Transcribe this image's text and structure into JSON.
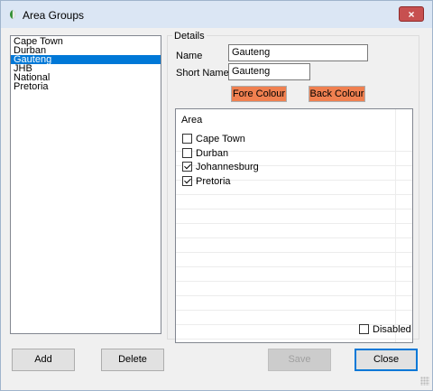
{
  "window": {
    "title": "Area Groups",
    "close_glyph": "×"
  },
  "area_list": {
    "items": [
      "Cape Town",
      "Durban",
      "Gauteng",
      "JHB",
      "National",
      "Pretoria"
    ],
    "selected": "Gauteng"
  },
  "details": {
    "group_title": "Details",
    "name_label": "Name",
    "name_value": "Gauteng",
    "short_name_label": "Short Name",
    "short_name_value": "Gauteng",
    "fore_colour_label": "Fore Colour",
    "back_colour_label": "Back Colour",
    "colour_swatch": "#f08050"
  },
  "area_grid": {
    "header": "Area",
    "rows": [
      {
        "label": "Cape Town",
        "checked": false
      },
      {
        "label": "Durban",
        "checked": false
      },
      {
        "label": "Johannesburg",
        "checked": true
      },
      {
        "label": "Pretoria",
        "checked": true
      }
    ]
  },
  "disabled_checkbox": {
    "label": "Disabled",
    "checked": false
  },
  "buttons": {
    "add": "Add",
    "delete": "Delete",
    "save": "Save",
    "close": "Close"
  },
  "colors": {
    "selection": "#0078d7",
    "titlebar": "#dbe6f4",
    "close_button": "#c75050"
  },
  "icons": {
    "app": "leaf-icon",
    "close": "close-icon",
    "grip": "resize-grip-icon"
  }
}
